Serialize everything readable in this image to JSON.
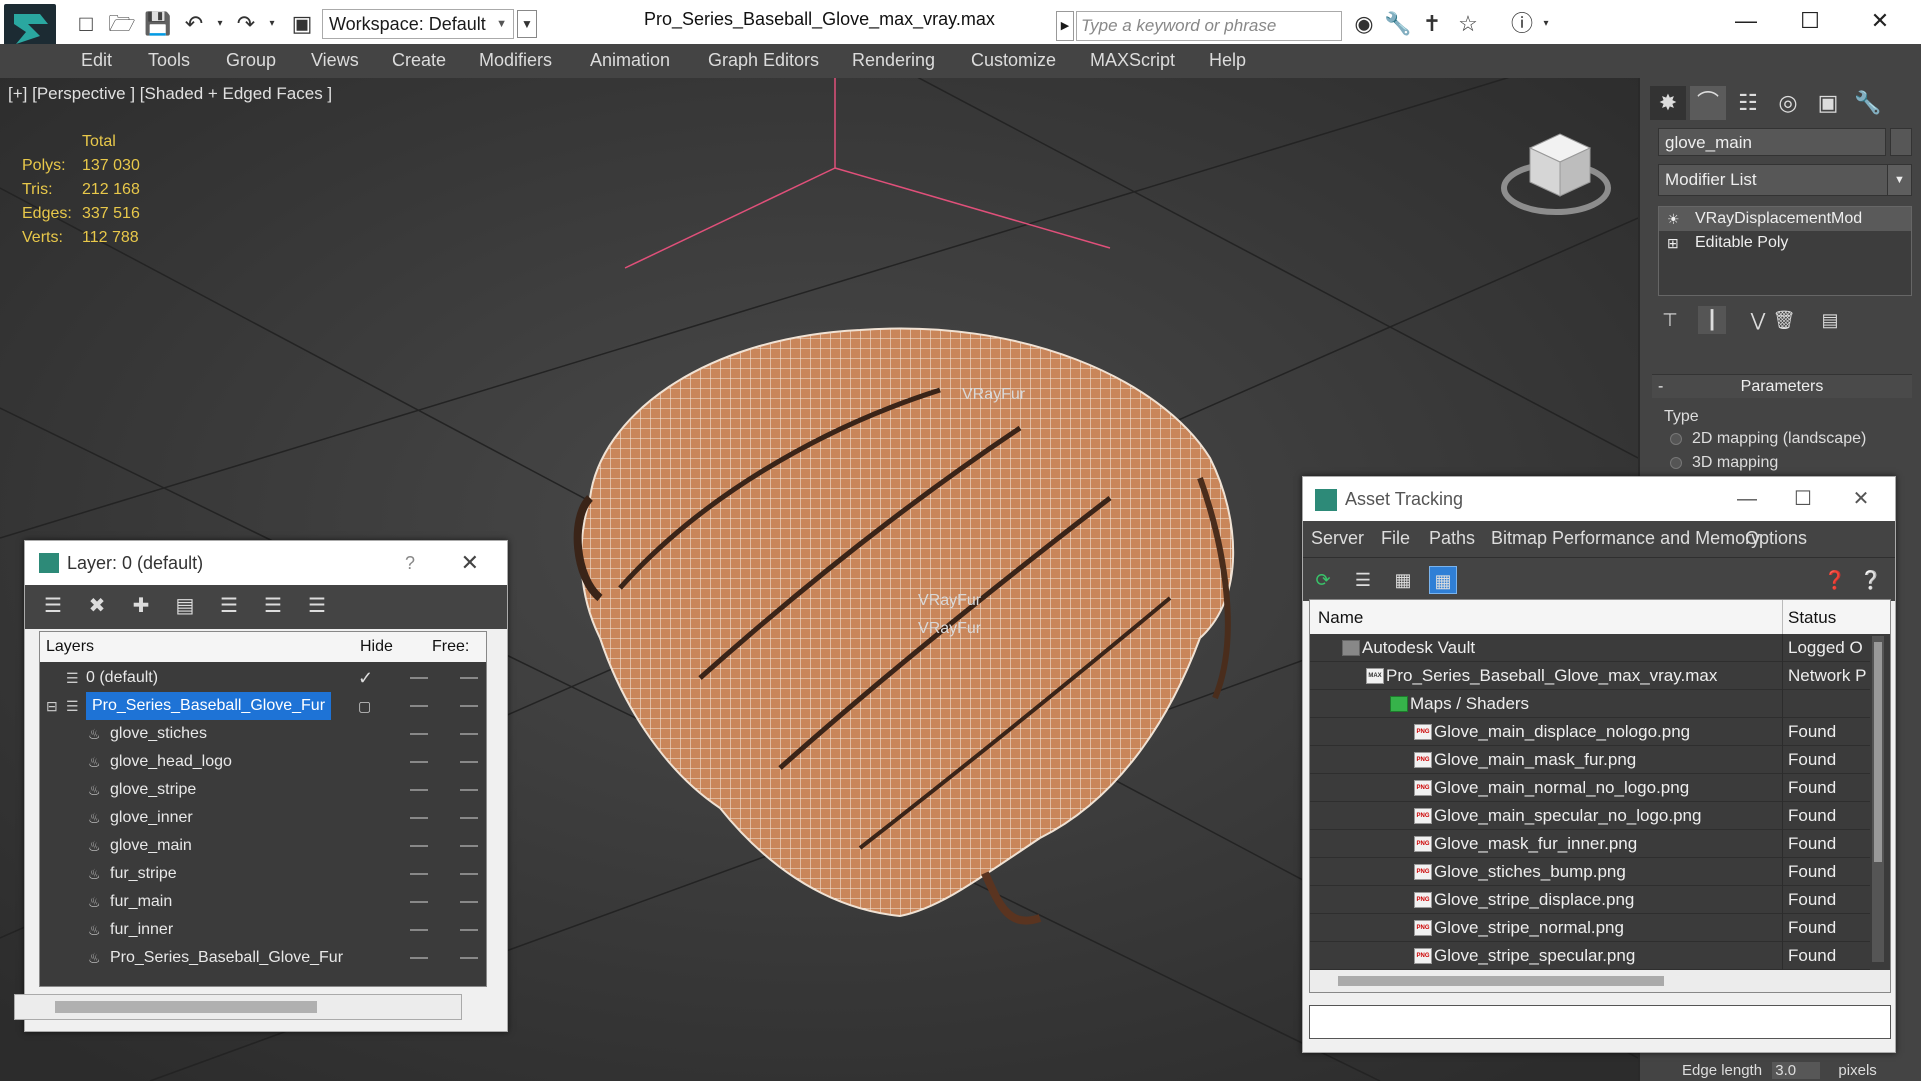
{
  "titlebar": {
    "workspace_label": "Workspace: Default",
    "app_title": "Pro_Series_Baseball_Glove_max_vray.max",
    "search_placeholder": "Type a keyword or phrase"
  },
  "menu": [
    "Edit",
    "Tools",
    "Group",
    "Views",
    "Create",
    "Modifiers",
    "Animation",
    "Graph Editors",
    "Rendering",
    "Customize",
    "MAXScript",
    "Help"
  ],
  "viewport": {
    "label": "[+] [Perspective ] [Shaded + Edged Faces ]",
    "stats": {
      "header": "Total",
      "rows": [
        {
          "k": "Polys:",
          "v": "137 030"
        },
        {
          "k": "Tris:",
          "v": "212 168"
        },
        {
          "k": "Edges:",
          "v": "337 516"
        },
        {
          "k": "Verts:",
          "v": "112 788"
        }
      ]
    },
    "object_labels": [
      "VRayFur",
      "VRayFur",
      "VRayFur"
    ]
  },
  "command_panel": {
    "object_name": "glove_main",
    "modifier_list_label": "Modifier List",
    "stack": [
      {
        "label": "VRayDisplacementMod",
        "icon": "lightbulb-icon"
      },
      {
        "label": "Editable Poly",
        "icon": "plus-box-icon"
      }
    ],
    "parameters_title": "Parameters",
    "type_label": "Type",
    "options": [
      "2D mapping (landscape)",
      "3D mapping"
    ],
    "edge_length_label": "Edge length",
    "edge_length_value": "3.0",
    "edge_length_unit": "pixels"
  },
  "layer_dialog": {
    "title": "Layer: 0 (default)",
    "help": "?",
    "columns": {
      "layers": "Layers",
      "hide": "Hide",
      "freeze": "Free:"
    },
    "rows": [
      {
        "name": "0 (default)",
        "level": 0
      },
      {
        "name": "Pro_Series_Baseball_Glove_Fur",
        "level": 0
      },
      {
        "name": "glove_stiches",
        "level": 1
      },
      {
        "name": "glove_head_logo",
        "level": 1
      },
      {
        "name": "glove_stripe",
        "level": 1
      },
      {
        "name": "glove_inner",
        "level": 1
      },
      {
        "name": "glove_main",
        "level": 1
      },
      {
        "name": "fur_stripe",
        "level": 1
      },
      {
        "name": "fur_main",
        "level": 1
      },
      {
        "name": "fur_inner",
        "level": 1
      },
      {
        "name": "Pro_Series_Baseball_Glove_Fur",
        "level": 1
      }
    ]
  },
  "asset_tracking": {
    "title": "Asset Tracking",
    "menu": [
      "Server",
      "File",
      "Paths",
      "Bitmap Performance and Memory",
      "Options"
    ],
    "columns": {
      "name": "Name",
      "status": "Status"
    },
    "rows": [
      {
        "name": "Autodesk Vault",
        "status": "Logged O",
        "indent": 0
      },
      {
        "name": "Pro_Series_Baseball_Glove_max_vray.max",
        "status": "Network P",
        "indent": 1
      },
      {
        "name": "Maps / Shaders",
        "status": "",
        "indent": 2
      },
      {
        "name": "Glove_main_displace_nologo.png",
        "status": "Found",
        "indent": 3
      },
      {
        "name": "Glove_main_mask_fur.png",
        "status": "Found",
        "indent": 3
      },
      {
        "name": "Glove_main_normal_no_logo.png",
        "status": "Found",
        "indent": 3
      },
      {
        "name": "Glove_main_specular_no_logo.png",
        "status": "Found",
        "indent": 3
      },
      {
        "name": "Glove_mask_fur_inner.png",
        "status": "Found",
        "indent": 3
      },
      {
        "name": "Glove_stiches_bump.png",
        "status": "Found",
        "indent": 3
      },
      {
        "name": "Glove_stripe_displace.png",
        "status": "Found",
        "indent": 3
      },
      {
        "name": "Glove_stripe_normal.png",
        "status": "Found",
        "indent": 3
      },
      {
        "name": "Glove_stripe_specular.png",
        "status": "Found",
        "indent": 3
      }
    ]
  }
}
